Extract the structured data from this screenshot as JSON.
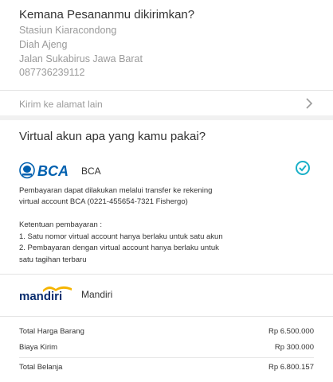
{
  "address": {
    "title": "Kemana Pesananmu dikirimkan?",
    "lines": [
      "Stasiun Kiaracondong",
      "Diah Ajeng",
      "Jalan Sukabirus Jawa Barat",
      "087736239112"
    ],
    "other_address_label": "Kirim ke alamat lain"
  },
  "payment": {
    "title": "Virtual akun apa yang kamu pakai?",
    "bca": {
      "logo_text": "BCA",
      "label": "BCA",
      "selected": true,
      "desc_lines": [
        "Pembayaran dapat dilakukan melalui transfer ke rekening",
        "virtual account BCA (0221-455654-7321 Fishergo)"
      ],
      "rules_title": "Ketentuan pembayaran :",
      "rules": [
        "1. Satu nomor virtual account hanya berlaku untuk satu akun",
        "2. Pembayaran dengan virtual account hanya berlaku untuk",
        "satu tagihan terbaru"
      ]
    },
    "mandiri": {
      "logo_text": "mandiri",
      "label": "Mandiri"
    }
  },
  "summary": {
    "items": [
      {
        "label": "Total Harga Barang",
        "value": "Rp 6.500.000"
      },
      {
        "label": "Biaya Kirim",
        "value": "Rp 300.000"
      }
    ],
    "total": {
      "label": "Total Belanja",
      "value": "Rp 6.800.157"
    }
  },
  "colors": {
    "bca_blue": "#0060af",
    "mandiri_navy": "#0a2d6e",
    "mandiri_gold": "#f5b400",
    "check_teal": "#1ab0c8"
  }
}
